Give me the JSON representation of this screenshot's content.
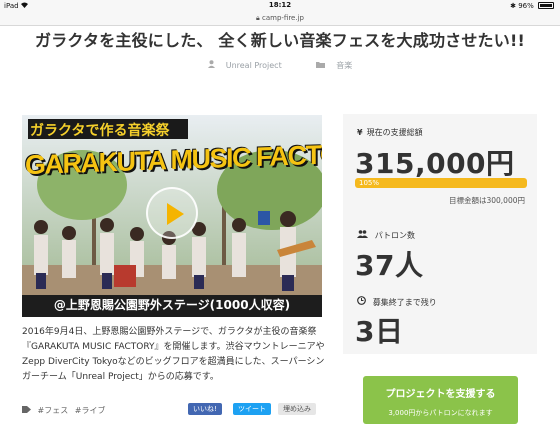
{
  "status": {
    "device": "iPad",
    "time": "18:12",
    "battery": "96%"
  },
  "browser": {
    "url": "camp-fire.jp"
  },
  "project": {
    "title": "ガラクタを主役にした、 全く新しい音楽フェスを大成功させたい!!",
    "owner": "Unreal Project",
    "category": "音楽",
    "description": "2016年9月4日、上野恩賜公園野外ステージで、ガラクタが主役の音楽祭『GARAKUTA MUSIC FACTORY』を開催します。渋谷マウントレーニアやZepp DiverCity Tokyoなどのビッグフロアを超満員にした、スーパーシンガーチーム「Unreal Project」からの応募です。",
    "tags": [
      "#フェス",
      "#ライブ"
    ]
  },
  "video": {
    "banner_top": "ガラクタで作る音楽祭",
    "banner_main": "GARAKUTA MUSIC FACTORY",
    "caption": "@上野恩賜公園野外ステージ(1000人収容)"
  },
  "social": {
    "like": "いいね!",
    "tweet": "ツイート",
    "embed": "埋め込み"
  },
  "stats": {
    "funding_label": "現在の支援総額",
    "funding_amount": "315,000円",
    "progress_text": "105%",
    "progress": 1.05,
    "goal_text": "目標金額は300,000円",
    "backers_label": "パトロン数",
    "backers_count": "37人",
    "remaining_label": "募集終了まで残り",
    "remaining_days": "3日"
  },
  "cta": {
    "label": "プロジェクトを支援する",
    "sub": "3,000円からパトロンになれます"
  },
  "colors": {
    "accent": "#f5b91e",
    "cta": "#8bc34a",
    "card": "#f5f5f5"
  }
}
